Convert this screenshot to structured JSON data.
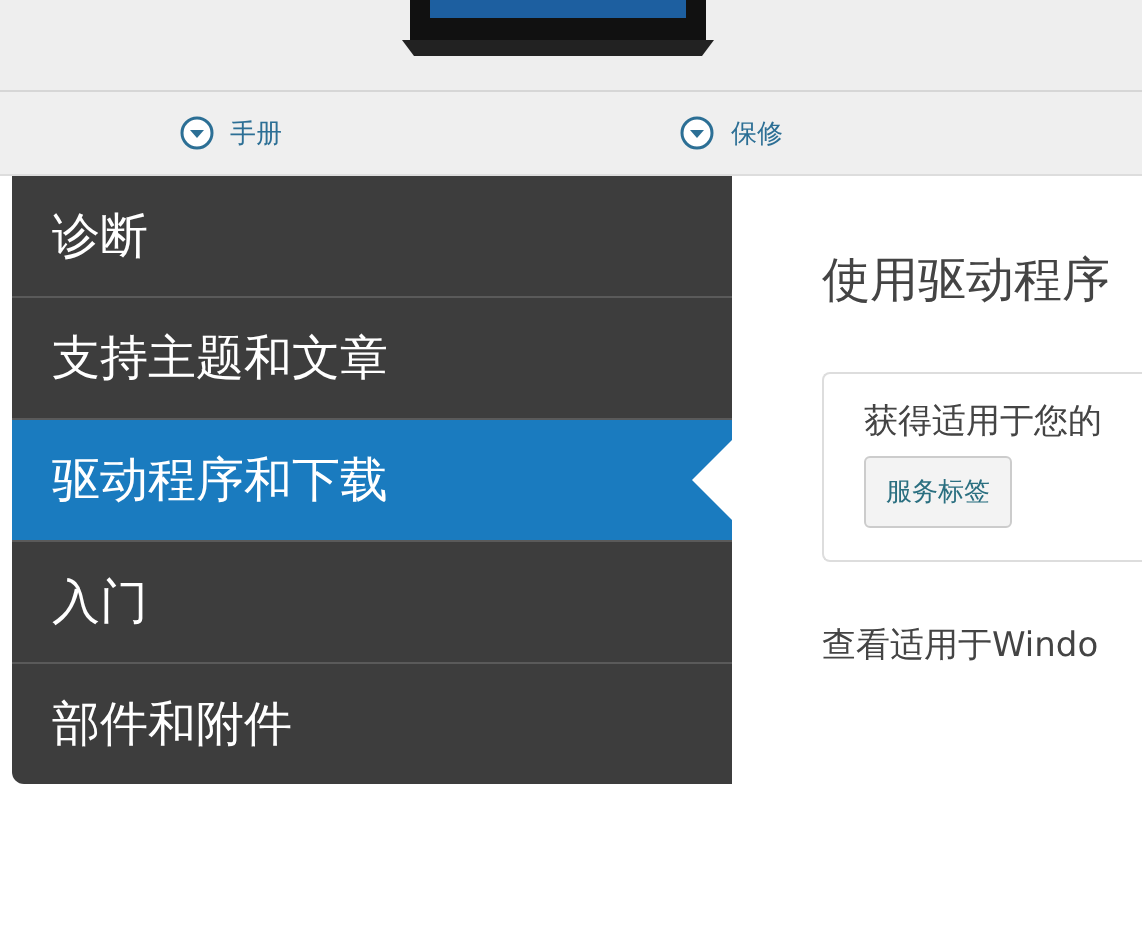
{
  "links": [
    {
      "label": "手册"
    },
    {
      "label": "保修"
    }
  ],
  "sidebar": {
    "items": [
      {
        "label": "诊断",
        "selected": false
      },
      {
        "label": "支持主题和文章",
        "selected": false
      },
      {
        "label": "驱动程序和下载",
        "selected": true
      },
      {
        "label": "入门",
        "selected": false
      },
      {
        "label": "部件和附件",
        "selected": false
      }
    ]
  },
  "content": {
    "heading": "使用驱动程序",
    "card_text": "获得适用于您的",
    "card_button": "服务标签",
    "note": "查看适用于Windo"
  }
}
